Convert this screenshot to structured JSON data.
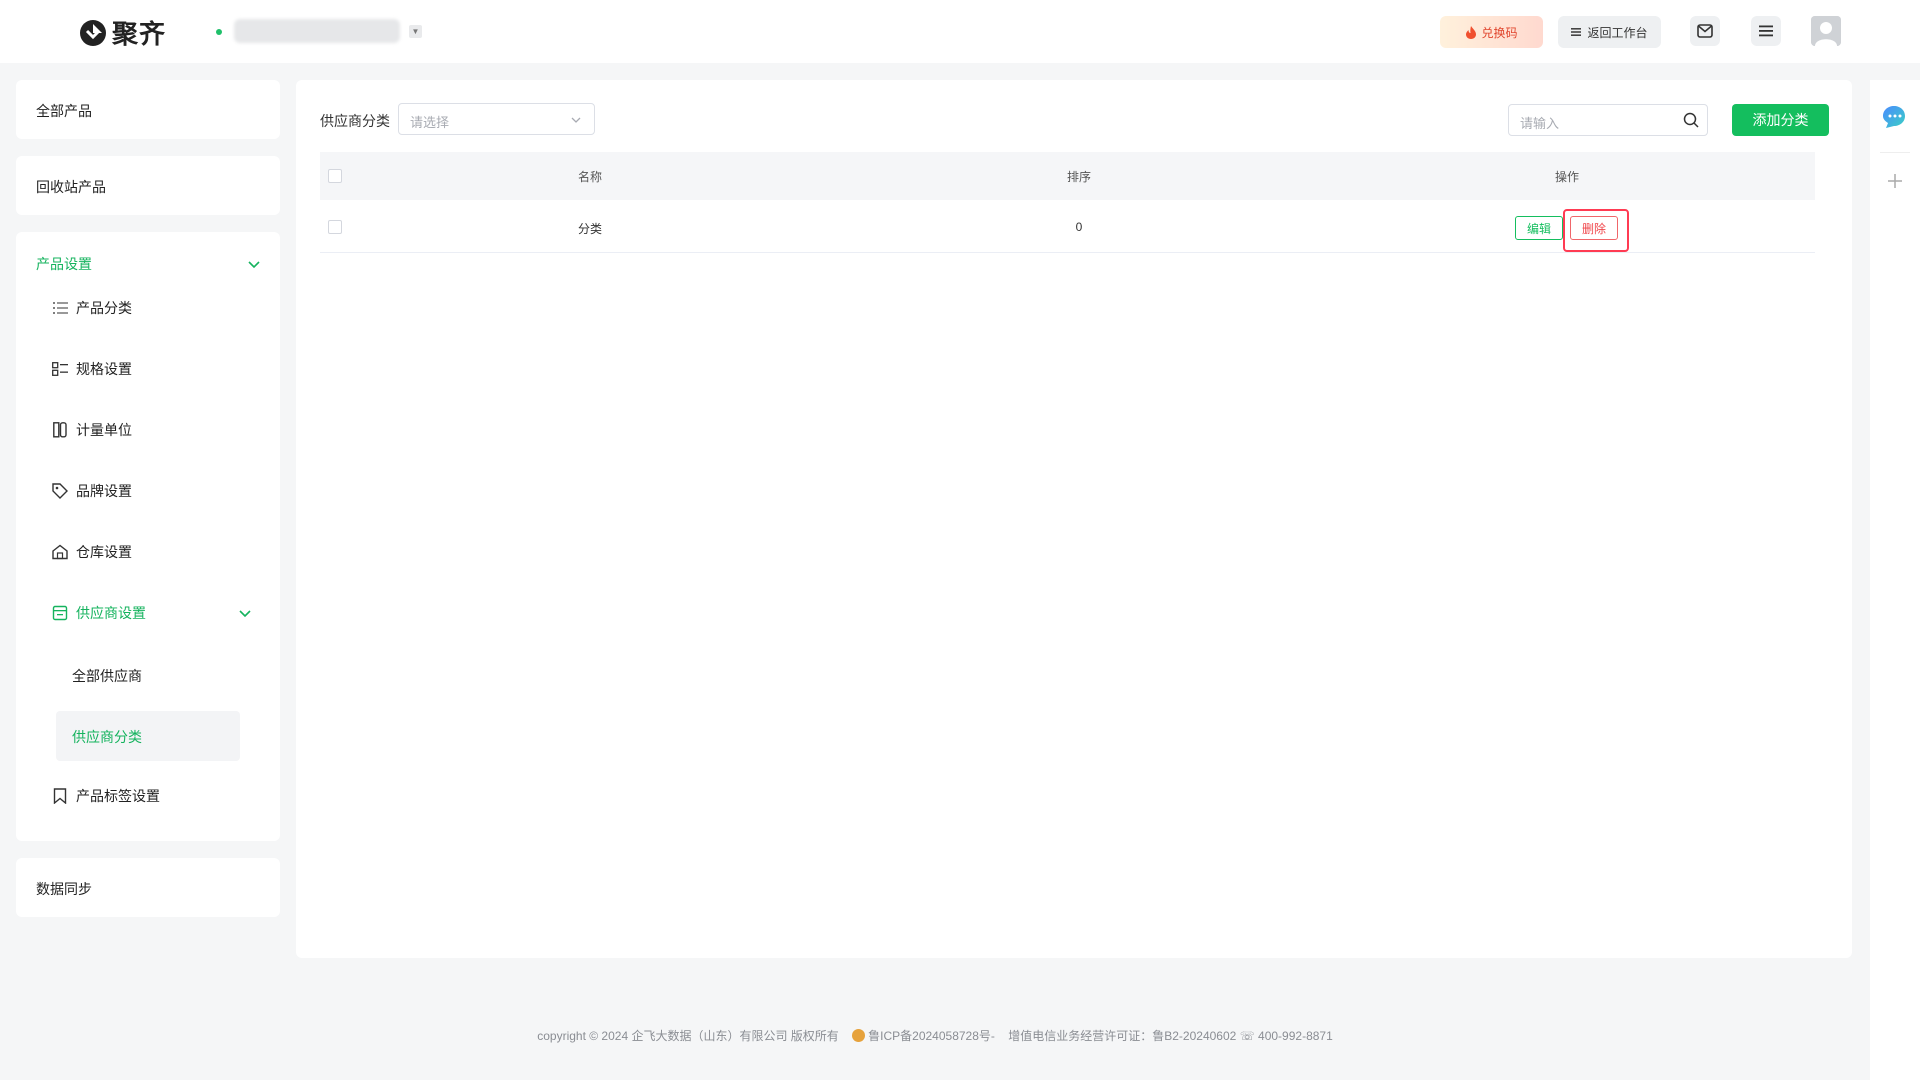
{
  "header": {
    "brand": "聚齐",
    "redeem_label": "兑换码",
    "back_label": "返回工作台"
  },
  "sidebar": {
    "all_products": "全部产品",
    "recycle_products": "回收站产品",
    "product_settings": {
      "title": "产品设置",
      "items": [
        {
          "label": "产品分类",
          "icon": "list-icon"
        },
        {
          "label": "规格设置",
          "icon": "spec-icon"
        },
        {
          "label": "计量单位",
          "icon": "unit-icon"
        },
        {
          "label": "品牌设置",
          "icon": "tag-icon"
        },
        {
          "label": "仓库设置",
          "icon": "warehouse-icon"
        }
      ],
      "supplier_group": {
        "title": "供应商设置",
        "items": [
          {
            "label": "全部供应商"
          },
          {
            "label": "供应商分类"
          }
        ]
      },
      "tag_settings": "产品标签设置"
    },
    "data_sync": "数据同步"
  },
  "main": {
    "filter_label": "供应商分类",
    "filter_placeholder": "请选择",
    "search_placeholder": "请输入",
    "add_button": "添加分类",
    "table": {
      "columns": [
        "名称",
        "排序",
        "操作"
      ],
      "rows": [
        {
          "name": "分类",
          "sort": "0",
          "edit": "编辑",
          "delete": "删除"
        }
      ]
    }
  },
  "footer": {
    "copyright": "copyright © 2024 企飞大数据（山东）有限公司 版权所有",
    "icp": "鲁ICP备2024058728号-",
    "license": "增值电信业务经营许可证：鲁B2-20240602",
    "phone": "400-992-8871"
  },
  "colors": {
    "accent": "#14be5e",
    "danger": "#f0464b",
    "highlight": "#ff3b53"
  }
}
